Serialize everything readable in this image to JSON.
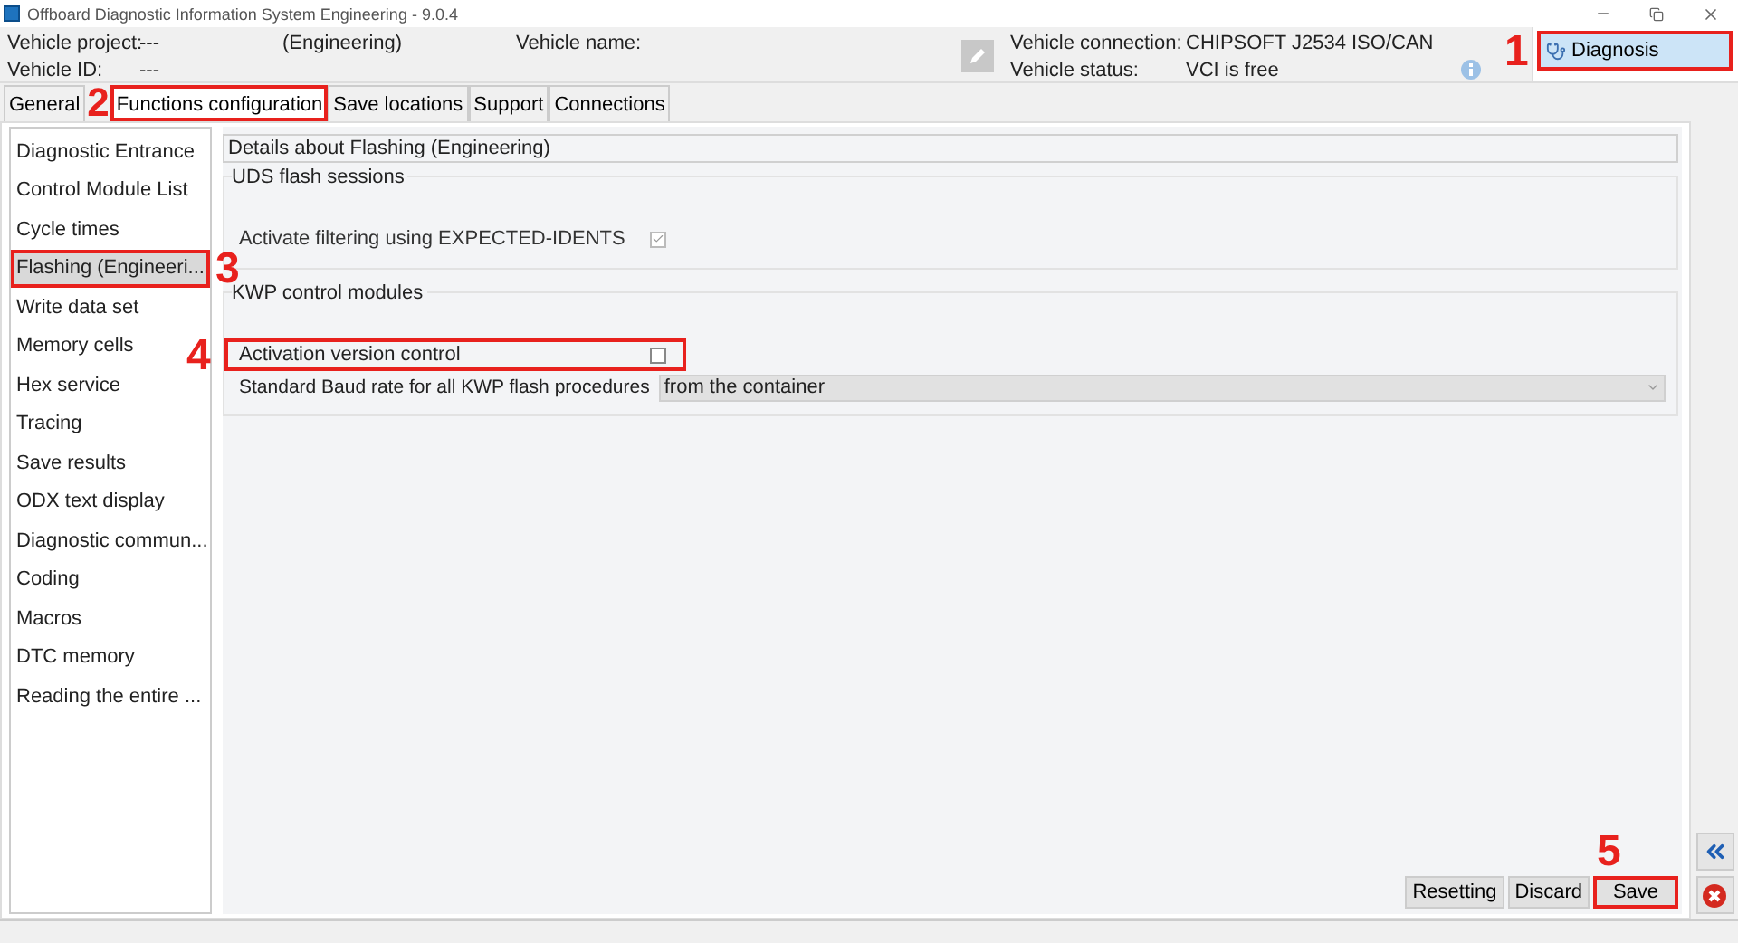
{
  "window": {
    "title": "Offboard Diagnostic Information System Engineering - 9.0.4"
  },
  "header": {
    "project_label": "Vehicle project:",
    "project_value": "---",
    "mode": "(Engineering)",
    "name_label": "Vehicle name:",
    "id_label": "Vehicle ID:",
    "id_value": "---",
    "connection_label": "Vehicle connection:",
    "connection_value": "CHIPSOFT J2534 ISO/CAN",
    "status_label": "Vehicle status:",
    "status_value": "VCI is free"
  },
  "diagnosis_button": {
    "label": "Diagnosis",
    "callout": "1"
  },
  "tabs": [
    {
      "label": "General",
      "selected": false
    },
    {
      "label": "Functions configuration",
      "selected": true,
      "callout": "2"
    },
    {
      "label": "Save locations",
      "selected": false
    },
    {
      "label": "Support",
      "selected": false
    },
    {
      "label": "Connections",
      "selected": false
    }
  ],
  "sidebar": {
    "items": [
      {
        "label": "Diagnostic Entrance",
        "selected": false
      },
      {
        "label": "Control Module List",
        "selected": false
      },
      {
        "label": "Cycle times",
        "selected": false
      },
      {
        "label": "Flashing (Engineeri...",
        "selected": true,
        "callout": "3"
      },
      {
        "label": "Write data set",
        "selected": false
      },
      {
        "label": "Memory cells",
        "selected": false
      },
      {
        "label": "Hex service",
        "selected": false
      },
      {
        "label": "Tracing",
        "selected": false
      },
      {
        "label": "Save results",
        "selected": false
      },
      {
        "label": "ODX text display",
        "selected": false
      },
      {
        "label": "Diagnostic commun...",
        "selected": false
      },
      {
        "label": "Coding",
        "selected": false
      },
      {
        "label": "Macros",
        "selected": false
      },
      {
        "label": "DTC memory",
        "selected": false
      },
      {
        "label": "Reading the entire ...",
        "selected": false
      }
    ]
  },
  "details": {
    "title": "Details about Flashing (Engineering)",
    "groups": [
      {
        "title": "UDS flash sessions",
        "options": [
          {
            "kind": "checkbox",
            "label": "Activate filtering using EXPECTED-IDENTS",
            "checked": true,
            "disabled": true
          }
        ]
      },
      {
        "title": "KWP control modules",
        "options": [
          {
            "kind": "checkbox",
            "label": "Activation version control",
            "checked": false,
            "disabled": false,
            "callout": "4"
          },
          {
            "kind": "select",
            "label": "Standard Baud rate for all KWP flash procedures",
            "value": "from the container"
          }
        ]
      }
    ]
  },
  "buttons": [
    {
      "label": "Resetting"
    },
    {
      "label": "Discard"
    },
    {
      "label": "Save",
      "callout": "5"
    }
  ]
}
